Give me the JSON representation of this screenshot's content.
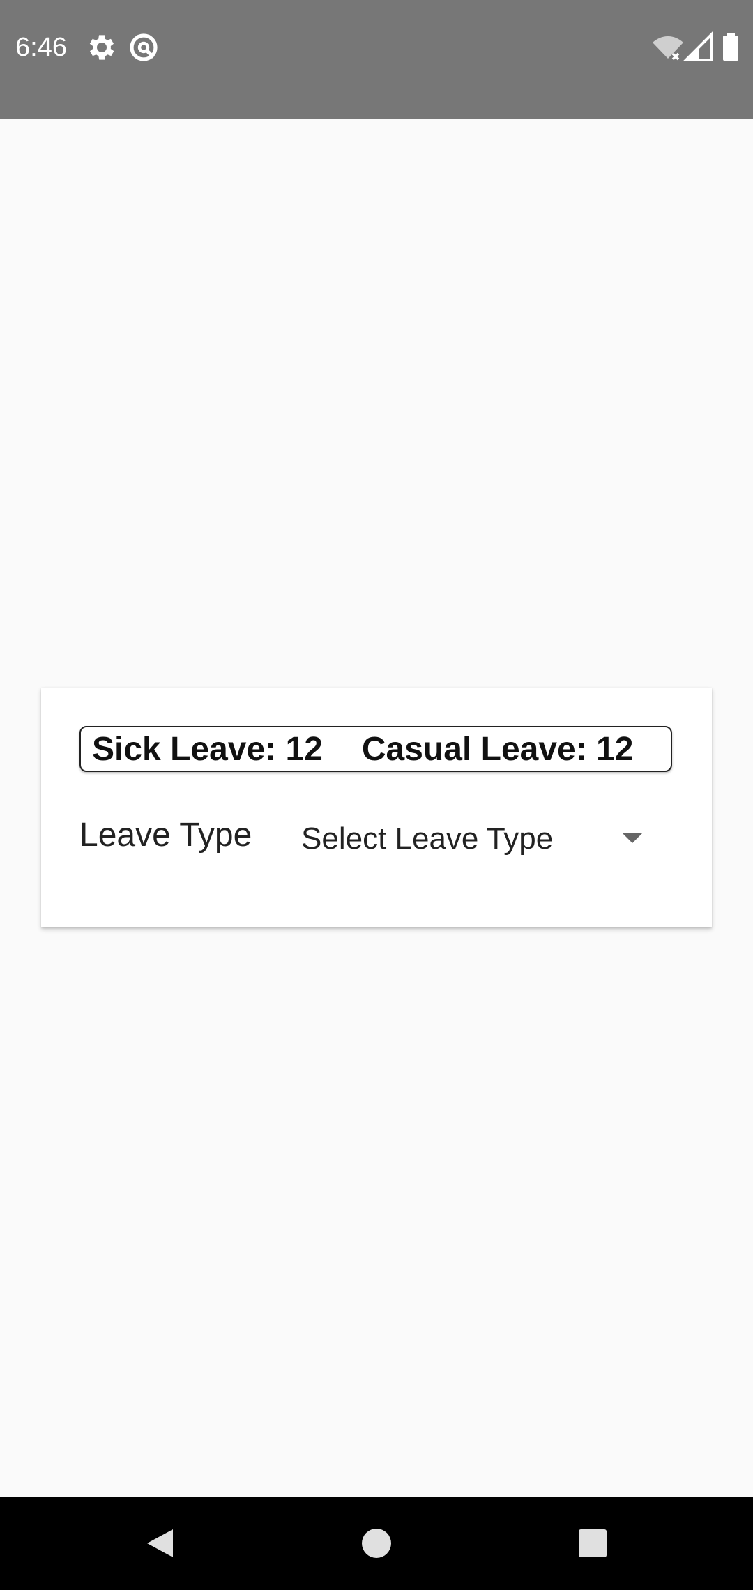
{
  "status_bar": {
    "time": "6:46",
    "icons": [
      "gear-icon",
      "data-saver-icon",
      "wifi-off-icon",
      "signal-icon",
      "battery-icon"
    ]
  },
  "leave_balance": {
    "sick": "Sick Leave: 12",
    "casual": "Casual Leave: 12"
  },
  "leave_type": {
    "label": "Leave Type",
    "select_value": "Select Leave Type"
  },
  "nav_bar": {
    "buttons": [
      "back-icon",
      "home-icon",
      "recents-icon"
    ]
  },
  "colors": {
    "status_bar": "#777777",
    "background": "#fafafa",
    "card": "#ffffff",
    "nav_bar": "#000000"
  }
}
